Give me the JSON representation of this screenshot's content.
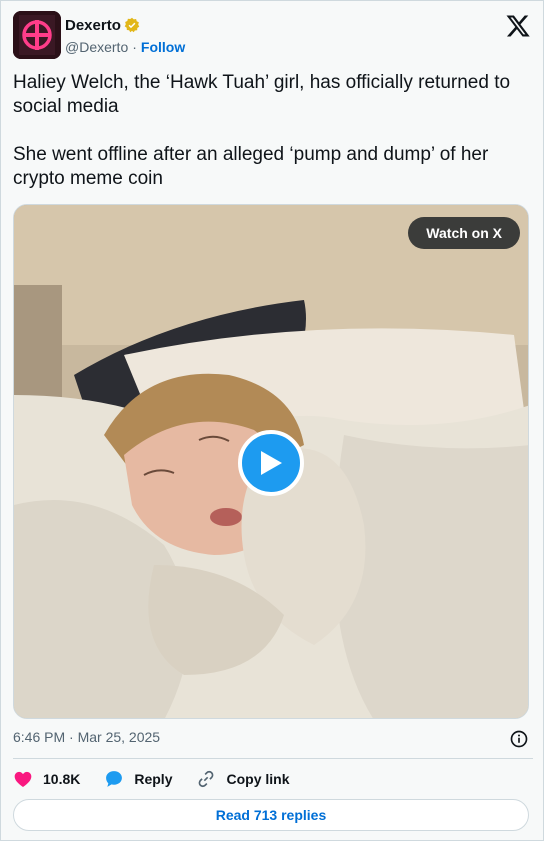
{
  "author": {
    "name": "Dexerto",
    "handle": "@Dexerto",
    "follow_label": "Follow"
  },
  "tweet": {
    "paragraphs": [
      "Haliey Welch, the ‘Hawk Tuah’ girl, has officially returned to social media",
      "She went offline after an alleged ‘pump and dump’ of her crypto meme coin"
    ]
  },
  "media": {
    "watch_label": "Watch on X"
  },
  "meta": {
    "timestamp": "6:46 PM · Mar 25, 2025"
  },
  "actions": {
    "likes": "10.8K",
    "reply_label": "Reply",
    "copy_label": "Copy link"
  },
  "read_replies_label": "Read 713 replies",
  "colors": {
    "like": "#f91880",
    "reply": "#1d9bf0",
    "link": "#006fd6",
    "verified": "#e2b719"
  }
}
